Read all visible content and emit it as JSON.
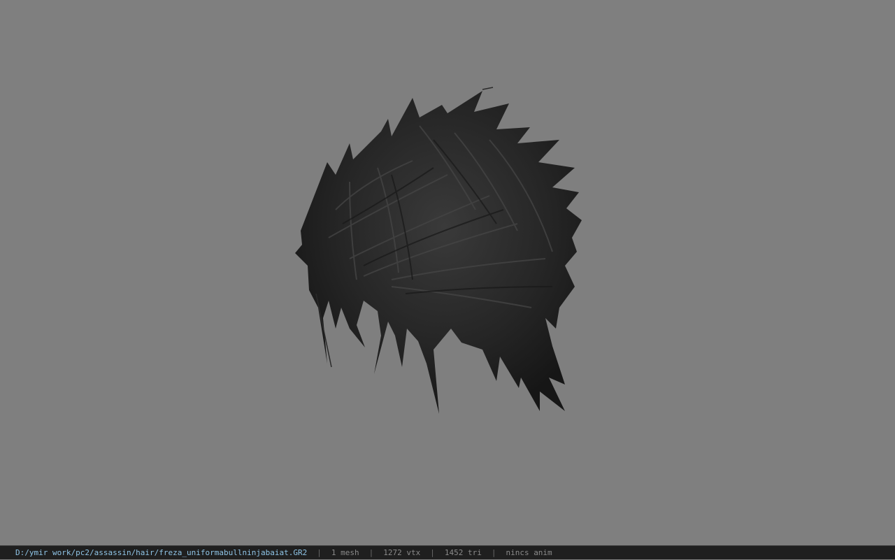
{
  "viewer": {
    "background_color": "#7f7f7f",
    "model_color": "#2a2a2a",
    "model_icon": "hair-mesh"
  },
  "status": {
    "path": "D:/ymir work/pc2/assassin/hair/freza_uniformabullninjabaiat.GR2",
    "separator": "|",
    "mesh_count": "1 mesh",
    "vertex_count": "1272 vtx",
    "triangle_count": "1452 tri",
    "anim": "nincs anim"
  }
}
